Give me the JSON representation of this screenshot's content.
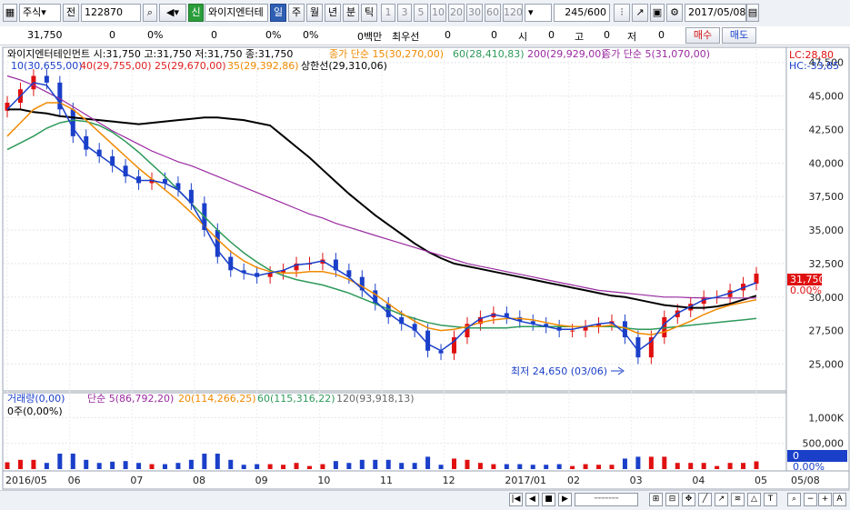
{
  "toolbar": {
    "type_select": "주식",
    "prev_label": "전",
    "code": "122870",
    "new_badge": "신",
    "stock_name": "와이지엔터테",
    "periods": [
      "일",
      "주",
      "월",
      "년",
      "분",
      "틱"
    ],
    "active_period": "일",
    "intervals": [
      "1",
      "3",
      "5",
      "10",
      "20",
      "30",
      "60",
      "120"
    ],
    "count": "245",
    "count_total": "/600",
    "date": "2017/05/08"
  },
  "infobar": {
    "price": "31,750",
    "change": "0",
    "change_pct": "0%",
    "volume": "0",
    "volume_pct": "0%",
    "amount_label": "0백만",
    "prefer_label": "최우선",
    "bid": "0",
    "ask": "0",
    "open_label": "시",
    "open": "0",
    "high_label": "고",
    "high": "0",
    "low_label": "저",
    "low": "0",
    "buy_label": "매수",
    "sell_label": "매도"
  },
  "price_legend": {
    "stock_line": "와이지엔터테인먼트 시:31,750 고:31,750 저:31,750 종:31,750",
    "ma15": "종가 단순 15(30,270,00)",
    "ma60": "60(28,410,83)",
    "ma200": "200(29,929,00)",
    "ma5_label": "종가 단순 5(31,070,00)",
    "row2_a": "10(30,655,00)",
    "row2_b": "40(29,755,00)",
    "row2_c": "25(29,670,00)",
    "row2_d": "35(29,392,86)",
    "upper_limit": "상한선(29,310,06)",
    "lc": "LC:28,80",
    "hc": "HC:-33,85"
  },
  "low_annotation": "최저 24,650 (03/06)",
  "current_price_tag": "31,750",
  "current_pct_tag": "0.00%",
  "volume_legend": {
    "title": "거래량(0,00)",
    "ma5": "단순 5(86,792,20)",
    "ma20": "20(114,266,25)",
    "ma60": "60(115,316,22)",
    "ma120": "120(93,918,13)",
    "sub": "0주(0,00%)",
    "zero_tag": "0",
    "zero_pct": "0.00%"
  },
  "colors": {
    "up": "#e01010",
    "down": "#1a3fc9",
    "ma5": "#1a3fc9",
    "ma10": "#e02020",
    "ma15": "#e07070",
    "ma20": "#f08a00",
    "ma60": "#2e9a5a",
    "ma120": "#000000",
    "ma200": "#9a2aa0"
  },
  "chart_data": {
    "type": "line",
    "price_axis": {
      "ticks": [
        "25,000",
        "27,500",
        "30,000",
        "32,500",
        "35,000",
        "37,500",
        "40,000",
        "42,500",
        "45,000",
        "47,500"
      ],
      "ylim": [
        23000,
        48500
      ]
    },
    "volume_axis": {
      "ticks": [
        "500,000",
        "1,000K"
      ],
      "ylim": [
        0,
        1200000
      ]
    },
    "x_ticks": [
      "2016/05",
      "06",
      "07",
      "08",
      "09",
      "10",
      "11",
      "12",
      "2017/01",
      "02",
      "03",
      "04",
      "05",
      "05/08"
    ],
    "series": [
      {
        "key": "close",
        "values": [
          44500,
          45500,
          46500,
          46000,
          44000,
          42000,
          41000,
          40500,
          39800,
          39000,
          38500,
          38800,
          38500,
          38000,
          37000,
          35000,
          33000,
          32000,
          31800,
          31500,
          31800,
          32000,
          32500,
          32500,
          32800,
          32000,
          31500,
          30500,
          29500,
          28500,
          28000,
          27500,
          26000,
          25800,
          27000,
          28000,
          28500,
          28800,
          28500,
          28200,
          28000,
          27800,
          27500,
          27500,
          27800,
          28000,
          28200,
          27000,
          25500,
          27000,
          28500,
          29000,
          29500,
          30000,
          30000,
          30500,
          31000,
          31750
        ]
      },
      {
        "key": "ma120",
        "values": [
          44000,
          44000,
          43800,
          43700,
          43500,
          43400,
          43300,
          43200,
          43100,
          43000,
          42900,
          43000,
          43100,
          43200,
          43300,
          43400,
          43400,
          43300,
          43200,
          43000,
          42800,
          42000,
          41200,
          40400,
          39500,
          38600,
          37700,
          36900,
          36100,
          35400,
          34700,
          34000,
          33400,
          32900,
          32500,
          32300,
          32100,
          31900,
          31700,
          31500,
          31300,
          31100,
          30900,
          30700,
          30500,
          30300,
          30100,
          30000,
          29800,
          29600,
          29400,
          29300,
          29200,
          29200,
          29300,
          29500,
          29800,
          30100
        ]
      },
      {
        "key": "ma200",
        "values": [
          46500,
          46200,
          45800,
          45300,
          44800,
          44200,
          43600,
          43000,
          42400,
          41900,
          41400,
          40900,
          40500,
          40100,
          39800,
          39400,
          39000,
          38600,
          38200,
          37800,
          37400,
          37000,
          36600,
          36200,
          35900,
          35500,
          35200,
          34900,
          34600,
          34300,
          34000,
          33700,
          33400,
          33100,
          32800,
          32500,
          32300,
          32100,
          31900,
          31700,
          31500,
          31300,
          31100,
          30900,
          30700,
          30500,
          30400,
          30300,
          30200,
          30100,
          30000,
          30000,
          29950,
          29940,
          29935,
          29930,
          29930,
          29929
        ]
      },
      {
        "key": "ma60",
        "values": [
          41000,
          41500,
          42000,
          42600,
          43000,
          43200,
          43100,
          42800,
          42300,
          41600,
          40800,
          39900,
          39000,
          38000,
          37000,
          36000,
          35000,
          34100,
          33300,
          32600,
          32000,
          31600,
          31300,
          31100,
          30900,
          30600,
          30300,
          29900,
          29500,
          29100,
          28700,
          28400,
          28100,
          27900,
          27800,
          27700,
          27700,
          27700,
          27700,
          27800,
          27800,
          27800,
          27800,
          27800,
          27800,
          27800,
          27800,
          27700,
          27600,
          27600,
          27700,
          27800,
          27900,
          28000,
          28100,
          28200,
          28300,
          28410
        ]
      },
      {
        "key": "ma20",
        "values": [
          42000,
          43000,
          44000,
          44500,
          44500,
          44000,
          43200,
          42300,
          41400,
          40500,
          39600,
          38800,
          38000,
          37200,
          36300,
          35300,
          34300,
          33400,
          32700,
          32200,
          31900,
          31800,
          31800,
          31900,
          31900,
          31700,
          31300,
          30800,
          30200,
          29500,
          28800,
          28200,
          27700,
          27500,
          27600,
          27800,
          28100,
          28300,
          28400,
          28400,
          28300,
          28100,
          27900,
          27800,
          27800,
          27800,
          27900,
          27700,
          27300,
          27200,
          27400,
          27800,
          28200,
          28700,
          29100,
          29400,
          29600,
          29800
        ]
      },
      {
        "key": "ma5",
        "values": [
          44000,
          45000,
          46000,
          45800,
          44500,
          42600,
          41300,
          40600,
          39900,
          39200,
          38700,
          38700,
          38500,
          38000,
          37000,
          35300,
          33500,
          32300,
          31800,
          31600,
          31800,
          32000,
          32400,
          32500,
          32700,
          32100,
          31500,
          30600,
          29700,
          28800,
          28100,
          27600,
          26500,
          26000,
          26700,
          27700,
          28400,
          28700,
          28500,
          28200,
          28000,
          27800,
          27600,
          27600,
          27800,
          28000,
          28100,
          27300,
          26000,
          26700,
          28000,
          28800,
          29300,
          29800,
          30000,
          30300,
          30700,
          31070
        ]
      }
    ]
  }
}
